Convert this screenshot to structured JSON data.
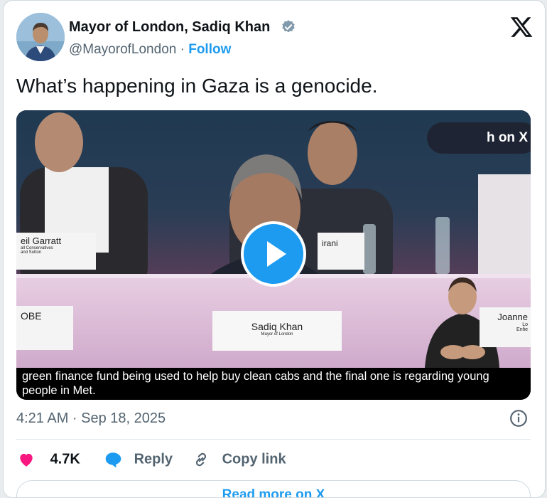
{
  "author": {
    "name": "Mayor of London, Sadiq Khan",
    "handle": "@MayorofLondon",
    "separator": "·",
    "follow_label": "Follow"
  },
  "tweet": {
    "text": "What’s happening in Gaza is a genocide."
  },
  "video": {
    "watch_label": "h on X",
    "caption": "green finance fund being used to help buy clean cabs and the final one is regarding young people in Met.",
    "name_cards": {
      "left_top": "eil Garratt",
      "left_top_sub1": "all Conservatives",
      "left_top_sub2": "and Sutton",
      "left_bottom": "OBE",
      "center_back": "irani",
      "center": "Sadiq Khan",
      "center_sub": "Mayor of London",
      "right": "Joanne",
      "right_sub1": "Lo",
      "right_sub2": "Enfie"
    }
  },
  "meta": {
    "timestamp": "4:21 AM · Sep 18, 2025"
  },
  "actions": {
    "like_count": "4.7K",
    "reply_label": "Reply",
    "copy_label": "Copy link"
  },
  "bottom_button": {
    "label": "Read more on X"
  },
  "colors": {
    "accent": "#1d9bf0",
    "like": "#f91880",
    "text": "#0f1419",
    "muted": "#536471"
  },
  "icons": [
    "verified-badge-icon",
    "x-logo-icon",
    "play-icon",
    "info-icon",
    "heart-icon",
    "reply-icon",
    "link-icon"
  ]
}
